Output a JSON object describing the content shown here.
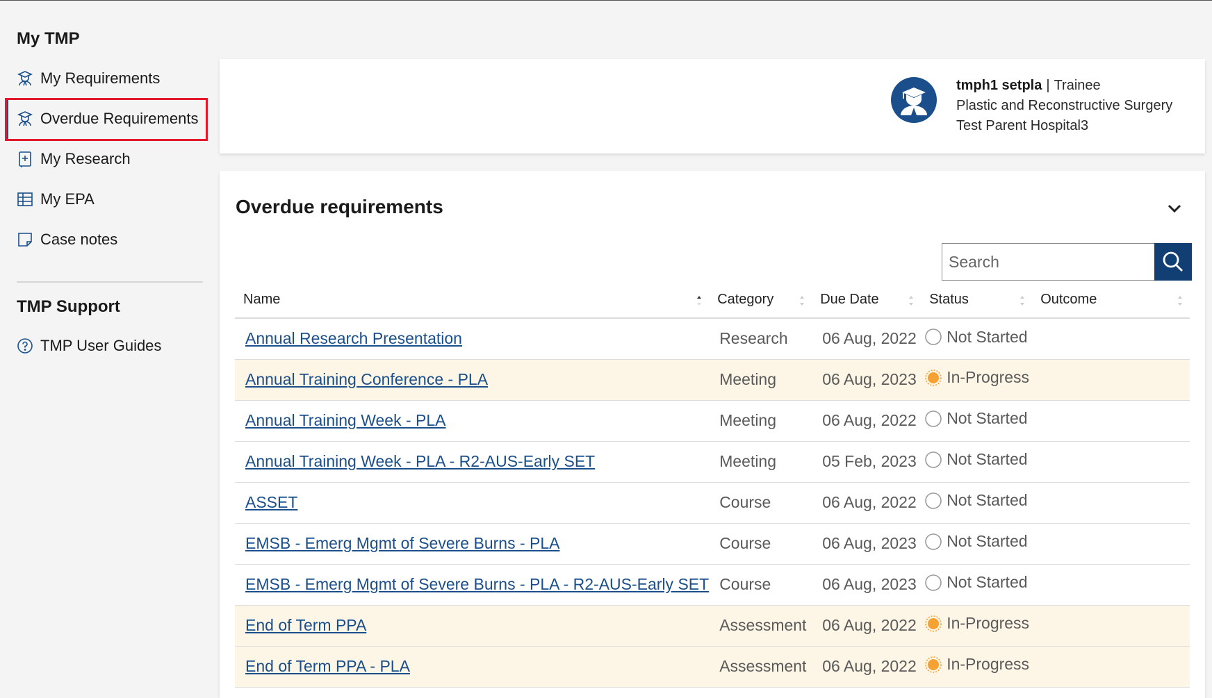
{
  "sidebar": {
    "section1_title": "My TMP",
    "items": [
      {
        "label": "My Requirements",
        "icon": "trainee-icon"
      },
      {
        "label": "Overdue Requirements",
        "icon": "trainee-icon",
        "active": true
      },
      {
        "label": "My Research",
        "icon": "research-plus-icon"
      },
      {
        "label": "My EPA",
        "icon": "table-grid-icon"
      },
      {
        "label": "Case notes",
        "icon": "sticky-note-icon"
      }
    ],
    "section2_title": "TMP Support",
    "support_items": [
      {
        "label": "TMP User Guides",
        "icon": "question-circle-icon"
      }
    ]
  },
  "profile": {
    "username": "tmph1 setpla",
    "separator": "|",
    "role": "Trainee",
    "specialty": "Plastic and Reconstructive Surgery",
    "hospital": "Test Parent Hospital3"
  },
  "main": {
    "title": "Overdue requirements",
    "search_placeholder": "Search",
    "columns": [
      "Name",
      "Category",
      "Due Date",
      "Status",
      "Outcome"
    ],
    "rows": [
      {
        "name": "Annual Research Presentation",
        "category": "Research",
        "due": "06 Aug, 2022",
        "status": "Not Started",
        "outcome": ""
      },
      {
        "name": "Annual Training Conference - PLA",
        "category": "Meeting",
        "due": "06 Aug, 2023",
        "status": "In-Progress",
        "outcome": ""
      },
      {
        "name": "Annual Training Week - PLA",
        "category": "Meeting",
        "due": "06 Aug, 2022",
        "status": "Not Started",
        "outcome": ""
      },
      {
        "name": "Annual Training Week - PLA - R2-AUS-Early SET",
        "category": "Meeting",
        "due": "05 Feb, 2023",
        "status": "Not Started",
        "outcome": ""
      },
      {
        "name": "ASSET",
        "category": "Course",
        "due": "06 Aug, 2022",
        "status": "Not Started",
        "outcome": ""
      },
      {
        "name": "EMSB - Emerg Mgmt of Severe Burns - PLA",
        "category": "Course",
        "due": "06 Aug, 2023",
        "status": "Not Started",
        "outcome": ""
      },
      {
        "name": "EMSB - Emerg Mgmt of Severe Burns - PLA - R2-AUS-Early SET",
        "category": "Course",
        "due": "06 Aug, 2023",
        "status": "Not Started",
        "outcome": ""
      },
      {
        "name": "End of Term PPA",
        "category": "Assessment",
        "due": "06 Aug, 2022",
        "status": "In-Progress",
        "outcome": ""
      },
      {
        "name": "End of Term PPA - PLA",
        "category": "Assessment",
        "due": "06 Aug, 2022",
        "status": "In-Progress",
        "outcome": ""
      }
    ]
  },
  "colors": {
    "accent": "#1a4f8b",
    "search_button": "#123f73",
    "active_outline": "#e3182d",
    "in_progress": "#f5a233",
    "highlight_row": "#fdf5e6"
  }
}
